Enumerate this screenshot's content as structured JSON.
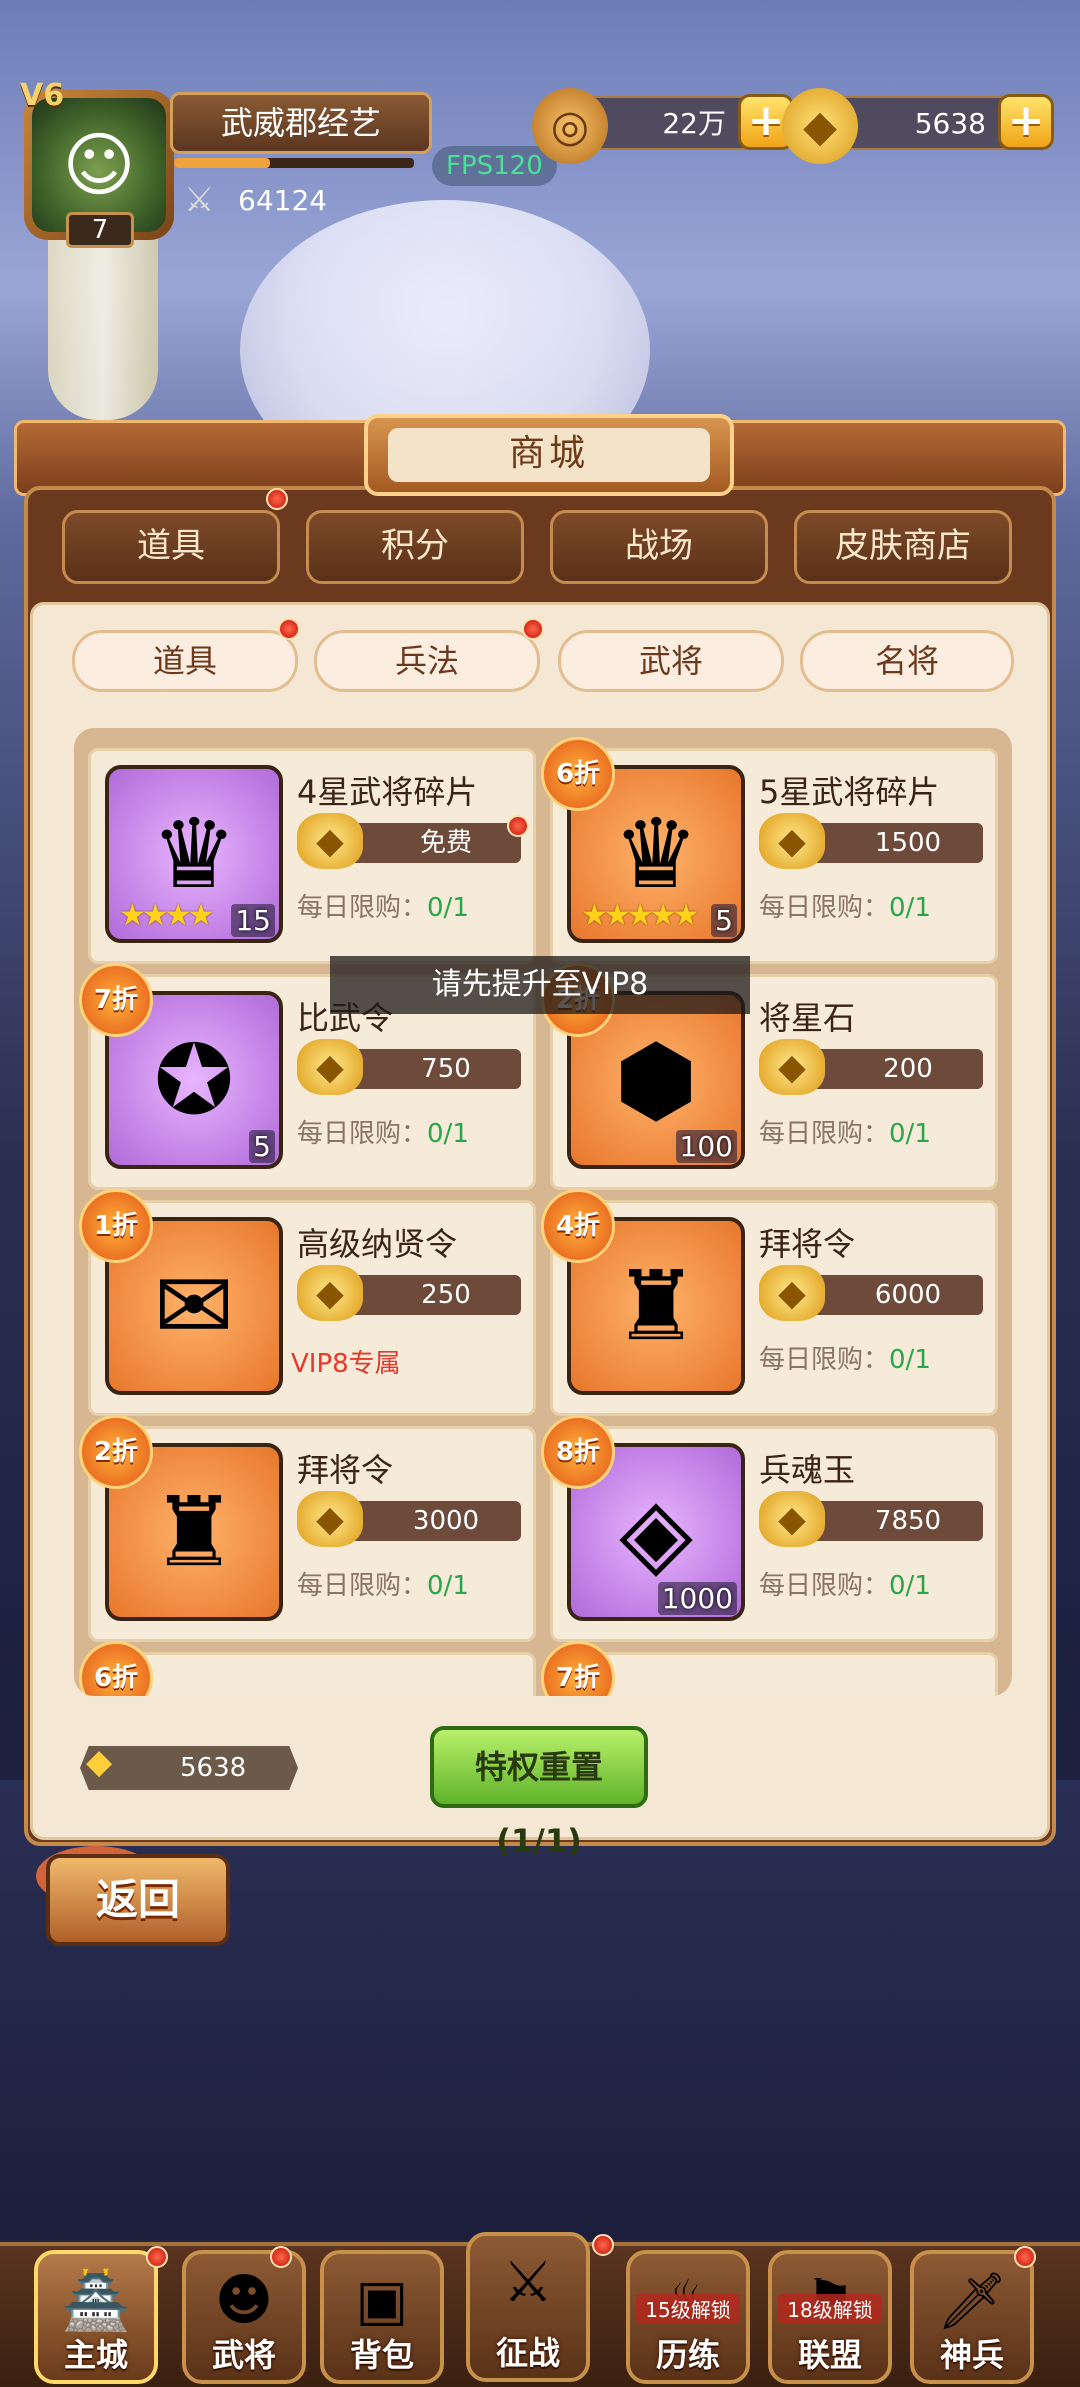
{
  "player": {
    "vip": "V6",
    "name": "武威郡经艺",
    "level": "7",
    "power": "64124",
    "fps": "FPS120",
    "exp_fraction": 0.4
  },
  "resources": {
    "coins": "22万",
    "gold": "5638"
  },
  "shop": {
    "title": "商城",
    "main_tabs": [
      {
        "label": "道具",
        "active": true,
        "badge": true
      },
      {
        "label": "积分",
        "active": false,
        "badge": false
      },
      {
        "label": "战场",
        "active": false,
        "badge": false
      },
      {
        "label": "皮肤商店",
        "active": false,
        "badge": false
      }
    ],
    "sub_tabs": [
      {
        "label": "道具",
        "active": true,
        "badge": true
      },
      {
        "label": "兵法",
        "active": false,
        "badge": true
      },
      {
        "label": "武将",
        "active": false,
        "badge": false
      },
      {
        "label": "名将",
        "active": false,
        "badge": false
      }
    ],
    "limit_label": "每日限购：",
    "items": [
      {
        "name": "4星武将碎片",
        "price": "免费",
        "count": "15",
        "stars": "★★★★",
        "limit": "0/1",
        "discount": "",
        "color": "purple",
        "icon": "helmet-shard-icon",
        "price_badge": true
      },
      {
        "name": "5星武将碎片",
        "price": "1500",
        "count": "5",
        "stars": "★★★★★",
        "limit": "0/1",
        "discount": "6折",
        "color": "orange",
        "icon": "helmet-shard-icon",
        "price_badge": false
      },
      {
        "name": "比武令",
        "price": "750",
        "count": "5",
        "stars": "",
        "limit": "0/1",
        "discount": "7折",
        "color": "purple",
        "icon": "token-icon",
        "price_badge": false
      },
      {
        "name": "将星石",
        "price": "200",
        "count": "100",
        "stars": "",
        "limit": "0/1",
        "discount": "2折",
        "color": "orange",
        "icon": "gem-icon",
        "price_badge": false
      },
      {
        "name": "高级纳贤令",
        "price": "250",
        "count": "",
        "stars": "",
        "limit": "",
        "vip_only": "VIP8专属",
        "discount": "1折",
        "color": "orange",
        "icon": "scroll-icon",
        "price_badge": false
      },
      {
        "name": "拜将令",
        "price": "6000",
        "count": "",
        "stars": "",
        "limit": "0/1",
        "discount": "4折",
        "color": "orange",
        "icon": "general-token-icon",
        "price_badge": false
      },
      {
        "name": "拜将令",
        "price": "3000",
        "count": "",
        "stars": "",
        "limit": "0/1",
        "discount": "2折",
        "color": "orange",
        "icon": "general-token-icon",
        "price_badge": false
      },
      {
        "name": "兵魂玉",
        "price": "7850",
        "count": "1000",
        "stars": "",
        "limit": "0/1",
        "discount": "8折",
        "color": "purple",
        "icon": "crystal-icon",
        "price_badge": false
      }
    ],
    "partial_discounts": [
      "6折",
      "7折"
    ],
    "toast": "请先提升至VIP8",
    "bottom_gold": "5638",
    "reset_button": "特权重置 (1/1)"
  },
  "back_button": "返回",
  "nav": [
    {
      "label": "主城",
      "active": true,
      "lock": "",
      "badge": true,
      "icon": "castle-icon"
    },
    {
      "label": "武将",
      "active": false,
      "lock": "",
      "badge": true,
      "icon": "warrior-icon"
    },
    {
      "label": "背包",
      "active": false,
      "lock": "",
      "badge": false,
      "icon": "chest-icon"
    },
    {
      "label": "征战",
      "active": false,
      "lock": "",
      "badge": true,
      "icon": "sword-icon"
    },
    {
      "label": "历练",
      "active": false,
      "lock": "15级解锁",
      "badge": false,
      "icon": "cauldron-icon"
    },
    {
      "label": "联盟",
      "active": false,
      "lock": "18级解锁",
      "badge": false,
      "icon": "alliance-icon"
    },
    {
      "label": "神兵",
      "active": false,
      "lock": "",
      "badge": true,
      "icon": "blade-icon"
    }
  ]
}
